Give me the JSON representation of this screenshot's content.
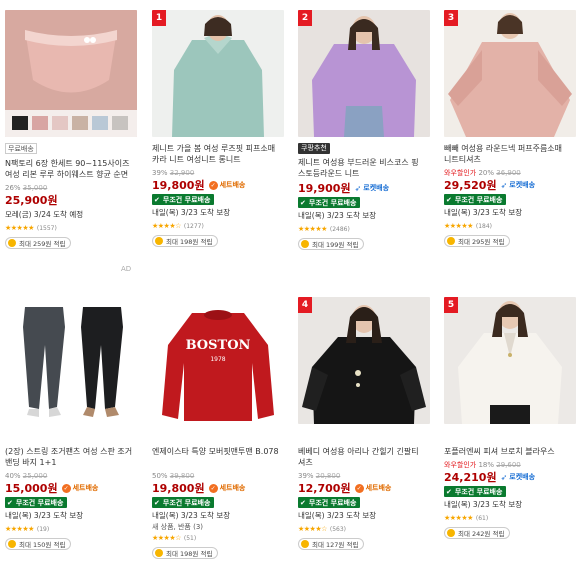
{
  "products": [
    {
      "rank": "",
      "tag": "무료배송",
      "name": "N팩토리 6장 한세트 90~115사이즈 여성 리본 루루 하이웨스트 향균 순면 팬티 빅사이즈",
      "discount": "26%",
      "original_price": "35,000",
      "price": "25,900원",
      "delivery": "모레(금) 3/24 도착 예정",
      "rating": 4.5,
      "review_count": "(1557)",
      "cash": "최대 259원 적립",
      "ad": "AD"
    },
    {
      "rank": "1",
      "name": "제니트 가을 봄 여성 루즈핏 피프소매 카라 니트 여성니트 롱니트",
      "discount": "39%",
      "original_price": "32,900",
      "price": "19,800원",
      "badge": "세트배송",
      "free_ship": "무조건 무료배송",
      "delivery": "내일(목) 3/23 도착 보장",
      "rating": 4.0,
      "review_count": "(1277)",
      "cash": "최대 198원 적립"
    },
    {
      "rank": "2",
      "tag": "쿠팡추천",
      "name": "제니트 여성용 부드러운 비스코스 핑 스토등라운드 니트",
      "price": "19,900원",
      "badge": "로켓배송",
      "free_ship": "무조건 무료배송",
      "delivery": "내일(목) 3/23 도착 보장",
      "rating": 4.5,
      "review_count": "(2486)",
      "cash": "최대 199원 적립"
    },
    {
      "rank": "3",
      "name": "빼빼 여성용 라운드넥 퍼프주름소매 니트티셔츠",
      "price_prefix": "와우할인가",
      "discount": "20%",
      "original_price": "36,900",
      "price": "29,520원",
      "badge": "로켓배송",
      "free_ship": "무조건 무료배송",
      "delivery": "내일(목) 3/23 도착 보장",
      "rating": 5.0,
      "review_count": "(184)",
      "cash": "최대 295원 적립"
    },
    {
      "rank": "",
      "name": "(2장) 스트링 조거팬츠 여성 스판 조거 밴딩 바지 1+1",
      "discount": "40%",
      "original_price": "25,000",
      "price": "15,000원",
      "badge": "세트배송",
      "free_ship": "무조건 무료배송",
      "delivery": "내일(목) 3/23 도착 보장",
      "rating": 4.5,
      "review_count": "(19)",
      "cash": "최대 150원 적립"
    },
    {
      "rank": "",
      "name": "엔제이스타 특양 모버핏맨투맨 B.078",
      "discount": "50%",
      "original_price": "39,800",
      "price": "19,800원",
      "badge": "세트배송",
      "free_ship": "무조건 무료배송",
      "delivery": "내일(목) 3/23 도착 보장",
      "extra": "새 상품, 반품 (3)",
      "rating": 4.0,
      "review_count": "(51)",
      "cash": "최대 198원 적립"
    },
    {
      "rank": "4",
      "name": "베베디 여성용 아리나 간힐기 긴팔티 셔츠",
      "discount": "39%",
      "original_price": "20,800",
      "price": "12,700원",
      "badge": "세트배송",
      "free_ship": "무조건 무료배송",
      "delivery": "내일(목) 3/23 도착 보장",
      "rating": 4.0,
      "review_count": "(563)",
      "cash": "최대 127원 적립"
    },
    {
      "rank": "5",
      "name": "포플러엔씨 피셔 브로치 블라우스",
      "price_prefix": "와우할인가",
      "discount": "18%",
      "original_price": "29,600",
      "price": "24,210원",
      "badge": "로켓배송",
      "free_ship": "무조건 무료배송",
      "delivery": "내일(목) 3/23 도착 보장",
      "rating": 4.5,
      "review_count": "(61)",
      "cash": "최대 242원 적립"
    }
  ],
  "image_texts": {
    "sweatshirt_line1": "BOSTON",
    "sweatshirt_line2": "1978"
  },
  "colors": {
    "price_red": "#ae0000",
    "rank_red": "#e41b23",
    "freeship_green": "#0a7a2f",
    "rocket_blue": "#1a6fd4",
    "set_orange": "#f26f21",
    "star": "#f7a600"
  }
}
